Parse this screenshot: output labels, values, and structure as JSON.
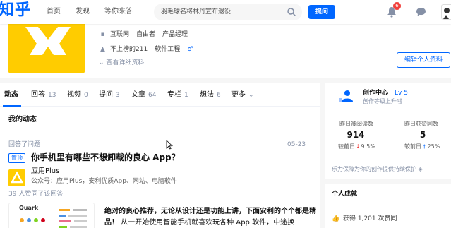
{
  "nav": {
    "logo": "知乎",
    "items": [
      "首页",
      "发现",
      "等你来答"
    ],
    "search_placeholder": "羽毛球名将林丹宣布退役",
    "ask_label": "提问",
    "notification_count": "6"
  },
  "profile": {
    "tags": [
      "互联网",
      "自由者",
      "产品经理"
    ],
    "school": "不上榜的211",
    "major": "软件工程",
    "gender_symbol": "♂",
    "detail_link": "查看详细资料",
    "edit_label": "编辑个人资料"
  },
  "tabs": [
    {
      "label": "动态",
      "count": ""
    },
    {
      "label": "回答",
      "count": "13"
    },
    {
      "label": "视频",
      "count": "0"
    },
    {
      "label": "提问",
      "count": "3"
    },
    {
      "label": "文章",
      "count": "64"
    },
    {
      "label": "专栏",
      "count": "1"
    },
    {
      "label": "想法",
      "count": "6"
    },
    {
      "label": "更多",
      "count": ""
    }
  ],
  "feed": {
    "section_title": "我的动态",
    "activity_label": "回答了问题",
    "activity_date": "05-23",
    "pin_label": "置顶",
    "question_title": "你手机里有哪些不想卸载的良心 App？",
    "author_name": "应用Plus",
    "author_desc": "公众号：应用Plus，安利优质App、网站、电脑软件",
    "agree_text": "39 人赞同了该回答",
    "thumb_label": "Quark",
    "excerpt_bold": "绝对的良心推荐，无论从设计还是功能上讲，下面安利的个个都是精品！",
    "excerpt_rest": " 从一开始使用智能手机就喜欢玩各种 App 软件，中途换"
  },
  "creator": {
    "title": "创作中心",
    "level": "Lv 5",
    "sub": "创作等级上升啦",
    "stats": [
      {
        "label": "昨日被阅读数",
        "value": "914",
        "cmp_prefix": "较前日",
        "arrow": "down",
        "cmp_value": "9.5%"
      },
      {
        "label": "昨日获赞同数",
        "value": "5",
        "cmp_prefix": "较前日",
        "arrow": "up",
        "cmp_value": "25%"
      }
    ],
    "note": "乐力保障为你的创作提供持续保护"
  },
  "achievement": {
    "title": "个人成就",
    "agree_text": "获得 1,201 次赞同"
  },
  "colors": {
    "brand": "#0066ff",
    "avatar_yellow": "#ffcc00",
    "badge_red": "#f1403c"
  }
}
